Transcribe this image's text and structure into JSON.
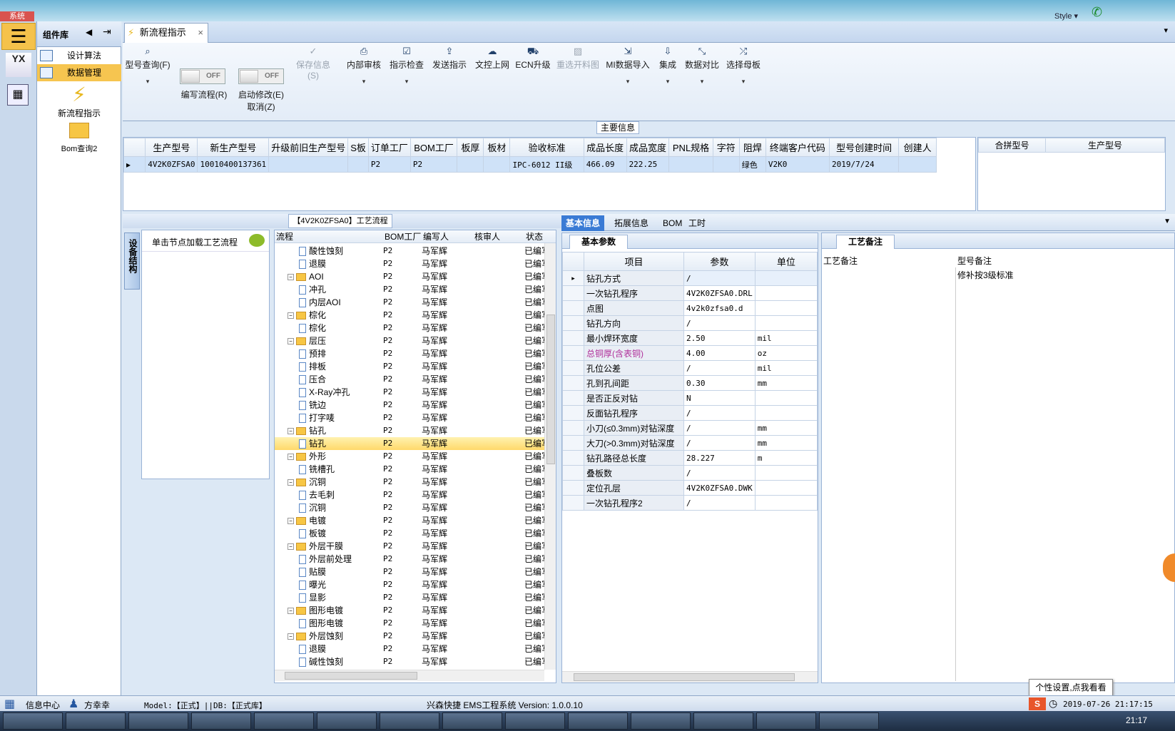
{
  "top": {
    "system_badge": "系统",
    "style_label": "Style"
  },
  "sidebar": {
    "header": "组件库",
    "items": [
      {
        "label": "设计算法"
      },
      {
        "label": "数据管理"
      }
    ],
    "big_buttons": [
      {
        "label": "新流程指示"
      },
      {
        "label": "Bom查询2"
      }
    ]
  },
  "tab": {
    "title": "新流程指示"
  },
  "toolbar": {
    "buttons": [
      {
        "label": "型号查询(F)",
        "icon": "search-icon"
      },
      {
        "label": "编写流程(R)",
        "toggle": "OFF"
      },
      {
        "label": "启动修改(E)",
        "toggle": "OFF",
        "sub": "取消(Z)"
      },
      {
        "label": "保存信息(S)",
        "icon": "check-icon"
      },
      {
        "label": "内部审核",
        "icon": "print-icon"
      },
      {
        "label": "指示检查",
        "icon": "checkbox-icon"
      },
      {
        "label": "发送指示",
        "icon": "upload-icon"
      },
      {
        "label": "文控上网",
        "icon": "cloud-icon"
      },
      {
        "label": "ECN升级",
        "icon": "ecn-icon"
      },
      {
        "label": "重选开料图",
        "icon": "image-icon"
      },
      {
        "label": "MI数据导入",
        "icon": "import-icon"
      },
      {
        "label": "集成",
        "icon": "download-icon"
      },
      {
        "label": "数据对比",
        "icon": "compare-icon"
      },
      {
        "label": "选择母板",
        "icon": "shuffle-icon"
      }
    ]
  },
  "main_info": {
    "title": "主要信息",
    "columns": [
      "生产型号",
      "新生产型号",
      "升级前旧生产型号",
      "S板",
      "订单工厂",
      "BOM工厂",
      "板厚",
      "板材",
      "验收标准",
      "成品长度",
      "成品宽度",
      "PNL规格",
      "字符",
      "阻焊",
      "终端客户代码",
      "型号创建时间",
      "创建人"
    ],
    "row": [
      "4V2K0ZFSA0",
      "10010400137361",
      "",
      "",
      "P2",
      "P2",
      "",
      "",
      "IPC-6012 II级",
      "466.09",
      "222.25",
      "",
      "",
      "绿色",
      "V2K0",
      "2019/7/24",
      ""
    ],
    "side_columns": [
      "合拼型号",
      "生产型号"
    ]
  },
  "process": {
    "title": "【4V2K0ZFSA0】工艺流程",
    "side_tab": "设备结构",
    "load_hint": "单击节点加载工艺流程",
    "columns": [
      "流程",
      "BOM工厂",
      "编写人",
      "核审人",
      "状态"
    ],
    "rows": [
      {
        "name": "酸性蚀刻",
        "level": 1,
        "bom": "P2",
        "author": "马军辉",
        "status": "已编写"
      },
      {
        "name": "退膜",
        "level": 1,
        "bom": "P2",
        "author": "马军辉",
        "status": "已编写"
      },
      {
        "name": "AOI",
        "level": 0,
        "bom": "P2",
        "author": "马军辉",
        "status": "已编写"
      },
      {
        "name": "冲孔",
        "level": 1,
        "bom": "P2",
        "author": "马军辉",
        "status": "已编写"
      },
      {
        "name": "内层AOI",
        "level": 1,
        "bom": "P2",
        "author": "马军辉",
        "status": "已编写"
      },
      {
        "name": "棕化",
        "level": 0,
        "bom": "P2",
        "author": "马军辉",
        "status": "已编写"
      },
      {
        "name": "棕化",
        "level": 1,
        "bom": "P2",
        "author": "马军辉",
        "status": "已编写"
      },
      {
        "name": "层压",
        "level": 0,
        "bom": "P2",
        "author": "马军辉",
        "status": "已编写"
      },
      {
        "name": "预排",
        "level": 1,
        "bom": "P2",
        "author": "马军辉",
        "status": "已编写"
      },
      {
        "name": "排板",
        "level": 1,
        "bom": "P2",
        "author": "马军辉",
        "status": "已编写"
      },
      {
        "name": "压合",
        "level": 1,
        "bom": "P2",
        "author": "马军辉",
        "status": "已编写"
      },
      {
        "name": "X-Ray冲孔",
        "level": 1,
        "bom": "P2",
        "author": "马军辉",
        "status": "已编写"
      },
      {
        "name": "铣边",
        "level": 1,
        "bom": "P2",
        "author": "马军辉",
        "status": "已编写"
      },
      {
        "name": "打字唛",
        "level": 1,
        "bom": "P2",
        "author": "马军辉",
        "status": "已编写"
      },
      {
        "name": "钻孔",
        "level": 0,
        "bom": "P2",
        "author": "马军辉",
        "status": "已编写"
      },
      {
        "name": "钻孔",
        "level": 1,
        "bom": "P2",
        "author": "马军辉",
        "status": "已编写",
        "selected": true
      },
      {
        "name": "外形",
        "level": 0,
        "bom": "P2",
        "author": "马军辉",
        "status": "已编写"
      },
      {
        "name": "铣槽孔",
        "level": 1,
        "bom": "P2",
        "author": "马军辉",
        "status": "已编写"
      },
      {
        "name": "沉铜",
        "level": 0,
        "bom": "P2",
        "author": "马军辉",
        "status": "已编写"
      },
      {
        "name": "去毛刺",
        "level": 1,
        "bom": "P2",
        "author": "马军辉",
        "status": "已编写"
      },
      {
        "name": "沉铜",
        "level": 1,
        "bom": "P2",
        "author": "马军辉",
        "status": "已编写"
      },
      {
        "name": "电镀",
        "level": 0,
        "bom": "P2",
        "author": "马军辉",
        "status": "已编写"
      },
      {
        "name": "板镀",
        "level": 1,
        "bom": "P2",
        "author": "马军辉",
        "status": "已编写"
      },
      {
        "name": "外层干膜",
        "level": 0,
        "bom": "P2",
        "author": "马军辉",
        "status": "已编写"
      },
      {
        "name": "外层前处理",
        "level": 1,
        "bom": "P2",
        "author": "马军辉",
        "status": "已编写"
      },
      {
        "name": "贴膜",
        "level": 1,
        "bom": "P2",
        "author": "马军辉",
        "status": "已编写"
      },
      {
        "name": "曝光",
        "level": 1,
        "bom": "P2",
        "author": "马军辉",
        "status": "已编写"
      },
      {
        "name": "显影",
        "level": 1,
        "bom": "P2",
        "author": "马军辉",
        "status": "已编写"
      },
      {
        "name": "图形电镀",
        "level": 0,
        "bom": "P2",
        "author": "马军辉",
        "status": "已编写"
      },
      {
        "name": "图形电镀",
        "level": 1,
        "bom": "P2",
        "author": "马军辉",
        "status": "已编写"
      },
      {
        "name": "外层蚀刻",
        "level": 0,
        "bom": "P2",
        "author": "马军辉",
        "status": "已编写"
      },
      {
        "name": "退膜",
        "level": 1,
        "bom": "P2",
        "author": "马军辉",
        "status": "已编写"
      },
      {
        "name": "碱性蚀刻",
        "level": 1,
        "bom": "P2",
        "author": "马军辉",
        "status": "已编写"
      }
    ]
  },
  "detail": {
    "tabs": [
      "基本信息",
      "拓展信息",
      "BOM",
      "工时"
    ],
    "param_tab": "基本参数",
    "param_columns": [
      "项目",
      "参数",
      "单位"
    ],
    "params": [
      {
        "item": "钻孔方式",
        "value": "/",
        "unit": ""
      },
      {
        "item": "一次钻孔程序",
        "value": "4V2K0ZFSA0.DRL",
        "unit": ""
      },
      {
        "item": "点图",
        "value": "4v2k0zfsa0.d",
        "unit": ""
      },
      {
        "item": "钻孔方向",
        "value": "/",
        "unit": ""
      },
      {
        "item": "最小焊环宽度",
        "value": "2.50",
        "unit": "mil"
      },
      {
        "item": "总铜厚(含表铜)",
        "value": "4.00",
        "unit": "oz",
        "highlight": true
      },
      {
        "item": "孔位公差",
        "value": "/",
        "unit": "mil"
      },
      {
        "item": "孔到孔间距",
        "value": "0.30",
        "unit": "mm"
      },
      {
        "item": "是否正反对钻",
        "value": "N",
        "unit": ""
      },
      {
        "item": "反面钻孔程序",
        "value": "/",
        "unit": ""
      },
      {
        "item": "小刀(≤0.3mm)对钻深度",
        "value": "/",
        "unit": "mm"
      },
      {
        "item": "大刀(>0.3mm)对钻深度",
        "value": "/",
        "unit": "mm"
      },
      {
        "item": "钻孔路径总长度",
        "value": "28.227",
        "unit": "m"
      },
      {
        "item": "叠板数",
        "value": "/",
        "unit": ""
      },
      {
        "item": "定位孔层",
        "value": "4V2K0ZFSA0.DWK",
        "unit": ""
      },
      {
        "item": "一次钻孔程序2",
        "value": "/",
        "unit": ""
      }
    ],
    "note_tab": "工艺备注",
    "note_columns": [
      "工艺备注",
      "型号备注"
    ],
    "model_note": "修补按3级标准"
  },
  "status_bar": {
    "info_center": "信息中心",
    "user": "方幸幸",
    "model_db": "Model:【正式】||DB:【正式库】",
    "app": "兴森快捷 EMS工程系统 Version: 1.0.0.10",
    "datetime": "2019-07-26 21:17:15"
  },
  "tooltip": "个性设置,点我看看",
  "taskbar": {
    "time": "21:17"
  },
  "colors": {
    "accent": "#f5c24b",
    "selected_row": "#ffe07a",
    "header_blue": "#3a7bd5",
    "highlight_text": "#b0309a"
  }
}
